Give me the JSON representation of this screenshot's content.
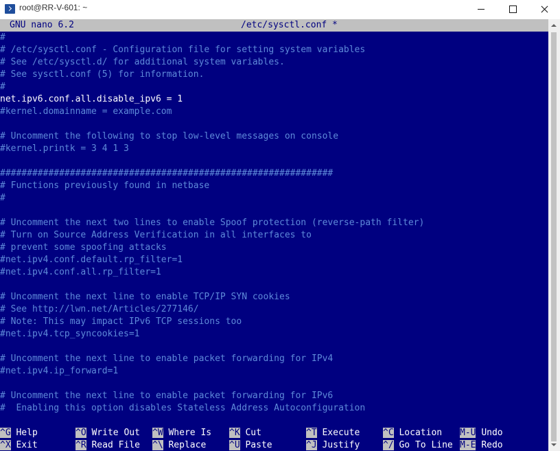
{
  "window": {
    "title": "root@RR-V-601: ~",
    "icon": "powershell-icon"
  },
  "nano": {
    "version": "GNU nano 6.2",
    "filename": "/etc/sysctl.conf *"
  },
  "buffer": {
    "lines": [
      {
        "text": "#",
        "kind": "comment"
      },
      {
        "text": "# /etc/sysctl.conf - Configuration file for setting system variables",
        "kind": "comment"
      },
      {
        "text": "# See /etc/sysctl.d/ for additional system variables.",
        "kind": "comment"
      },
      {
        "text": "# See sysctl.conf (5) for information.",
        "kind": "comment"
      },
      {
        "text": "#",
        "kind": "comment"
      },
      {
        "text": "net.ipv6.conf.all.disable_ipv6 = 1",
        "kind": "active"
      },
      {
        "text": "#kernel.domainname = example.com",
        "kind": "comment"
      },
      {
        "text": "",
        "kind": "comment"
      },
      {
        "text": "# Uncomment the following to stop low-level messages on console",
        "kind": "comment"
      },
      {
        "text": "#kernel.printk = 3 4 1 3",
        "kind": "comment"
      },
      {
        "text": "",
        "kind": "comment"
      },
      {
        "text": "##############################################################",
        "kind": "comment"
      },
      {
        "text": "# Functions previously found in netbase",
        "kind": "comment"
      },
      {
        "text": "#",
        "kind": "comment"
      },
      {
        "text": "",
        "kind": "comment"
      },
      {
        "text": "# Uncomment the next two lines to enable Spoof protection (reverse-path filter)",
        "kind": "comment"
      },
      {
        "text": "# Turn on Source Address Verification in all interfaces to",
        "kind": "comment"
      },
      {
        "text": "# prevent some spoofing attacks",
        "kind": "comment"
      },
      {
        "text": "#net.ipv4.conf.default.rp_filter=1",
        "kind": "comment"
      },
      {
        "text": "#net.ipv4.conf.all.rp_filter=1",
        "kind": "comment"
      },
      {
        "text": "",
        "kind": "comment"
      },
      {
        "text": "# Uncomment the next line to enable TCP/IP SYN cookies",
        "kind": "comment"
      },
      {
        "text": "# See http://lwn.net/Articles/277146/",
        "kind": "comment"
      },
      {
        "text": "# Note: This may impact IPv6 TCP sessions too",
        "kind": "comment"
      },
      {
        "text": "#net.ipv4.tcp_syncookies=1",
        "kind": "comment"
      },
      {
        "text": "",
        "kind": "comment"
      },
      {
        "text": "# Uncomment the next line to enable packet forwarding for IPv4",
        "kind": "comment"
      },
      {
        "text": "#net.ipv4.ip_forward=1",
        "kind": "comment"
      },
      {
        "text": "",
        "kind": "comment"
      },
      {
        "text": "# Uncomment the next line to enable packet forwarding for IPv6",
        "kind": "comment"
      },
      {
        "text": "#  Enabling this option disables Stateless Address Autoconfiguration",
        "kind": "comment"
      }
    ]
  },
  "shortcuts": [
    {
      "key": "^G",
      "label": "Help"
    },
    {
      "key": "^X",
      "label": "Exit"
    },
    {
      "key": "^O",
      "label": "Write Out"
    },
    {
      "key": "^R",
      "label": "Read File"
    },
    {
      "key": "^W",
      "label": "Where Is"
    },
    {
      "key": "^\\",
      "label": "Replace"
    },
    {
      "key": "^K",
      "label": "Cut"
    },
    {
      "key": "^U",
      "label": "Paste"
    },
    {
      "key": "^T",
      "label": "Execute"
    },
    {
      "key": "^J",
      "label": "Justify"
    },
    {
      "key": "^C",
      "label": "Location"
    },
    {
      "key": "^/",
      "label": "Go To Line"
    },
    {
      "key": "M-U",
      "label": "Undo"
    },
    {
      "key": "M-E",
      "label": "Redo"
    }
  ],
  "colors": {
    "terminal_bg": "#000080",
    "header_bg": "#c0c0c0",
    "comment": "#5e8ad9",
    "text": "#ffffff"
  }
}
